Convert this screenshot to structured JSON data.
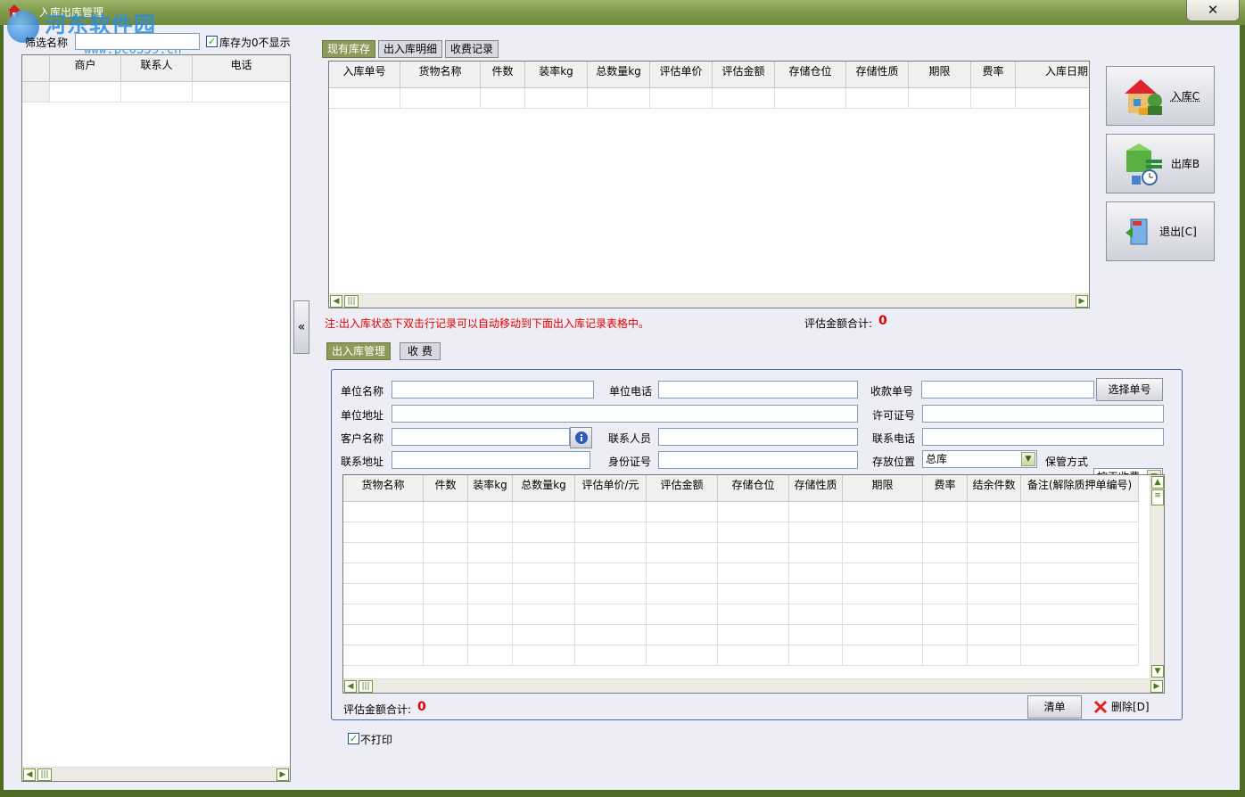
{
  "window": {
    "title": "入库出库管理",
    "close_glyph": "✕"
  },
  "watermark": {
    "main": "河东软件园",
    "url": "www.pc0359.cn"
  },
  "filter": {
    "label": "筛选名称",
    "value": "",
    "zero_stock_label": "库存为0不显示",
    "zero_stock_checked": true
  },
  "left_table": {
    "columns": [
      "商户",
      "联系人",
      "电话"
    ]
  },
  "collapse_glyph": "«",
  "tabs_top": {
    "items": [
      {
        "label": "现有库存",
        "active": true
      },
      {
        "label": "出入库明细",
        "active": false
      },
      {
        "label": "收费记录",
        "active": false
      }
    ]
  },
  "top_table": {
    "columns": [
      "入库单号",
      "货物名称",
      "件数",
      "装率kg",
      "总数量kg",
      "评估单价",
      "评估金额",
      "存储仓位",
      "存储性质",
      "期限",
      "费率",
      "入库日期"
    ]
  },
  "note": "注:出入库状态下双击行记录可以自动移动到下面出入库记录表格中。",
  "top_total": {
    "label": "评估金额合计:",
    "value": "0"
  },
  "side_buttons": {
    "in": "入库C",
    "out": "出库B",
    "exit": "退出[C]"
  },
  "tabs_bottom": {
    "items": [
      {
        "label": "出入库管理",
        "active": true
      },
      {
        "label": "收 费",
        "active": false
      }
    ]
  },
  "form": {
    "unit_name": {
      "label": "单位名称",
      "value": ""
    },
    "unit_phone": {
      "label": "单位电话",
      "value": ""
    },
    "receipt_no": {
      "label": "收款单号",
      "value": ""
    },
    "select_no_button": "选择单号",
    "unit_address": {
      "label": "单位地址",
      "value": ""
    },
    "license_no": {
      "label": "许可证号",
      "value": ""
    },
    "customer_name": {
      "label": "客户名称",
      "value": ""
    },
    "contact_person": {
      "label": "联系人员",
      "value": ""
    },
    "contact_phone": {
      "label": "联系电话",
      "value": ""
    },
    "contact_address": {
      "label": "联系地址",
      "value": ""
    },
    "id_no": {
      "label": "身份证号",
      "value": ""
    },
    "storage_location": {
      "label": "存放位置",
      "value": "总库"
    },
    "storage_method": {
      "label": "保管方式",
      "value": "按天收费"
    }
  },
  "bottom_table": {
    "columns": [
      "货物名称",
      "件数",
      "装率kg",
      "总数量kg",
      "评估单价/元",
      "评估金额",
      "存储仓位",
      "存储性质",
      "期限",
      "费率",
      "结余件数",
      "备注(解除质押单编号)"
    ]
  },
  "bottom_total": {
    "label": "评估金额合计:",
    "value": "0"
  },
  "actions": {
    "clear": "清单",
    "delete": "删除[D]"
  },
  "no_print": {
    "label": "不打印",
    "checked": true
  },
  "colors": {
    "titlebar": "#7f9a4c",
    "accent_red": "#e00000",
    "tab_active": "#8d9a5a"
  }
}
